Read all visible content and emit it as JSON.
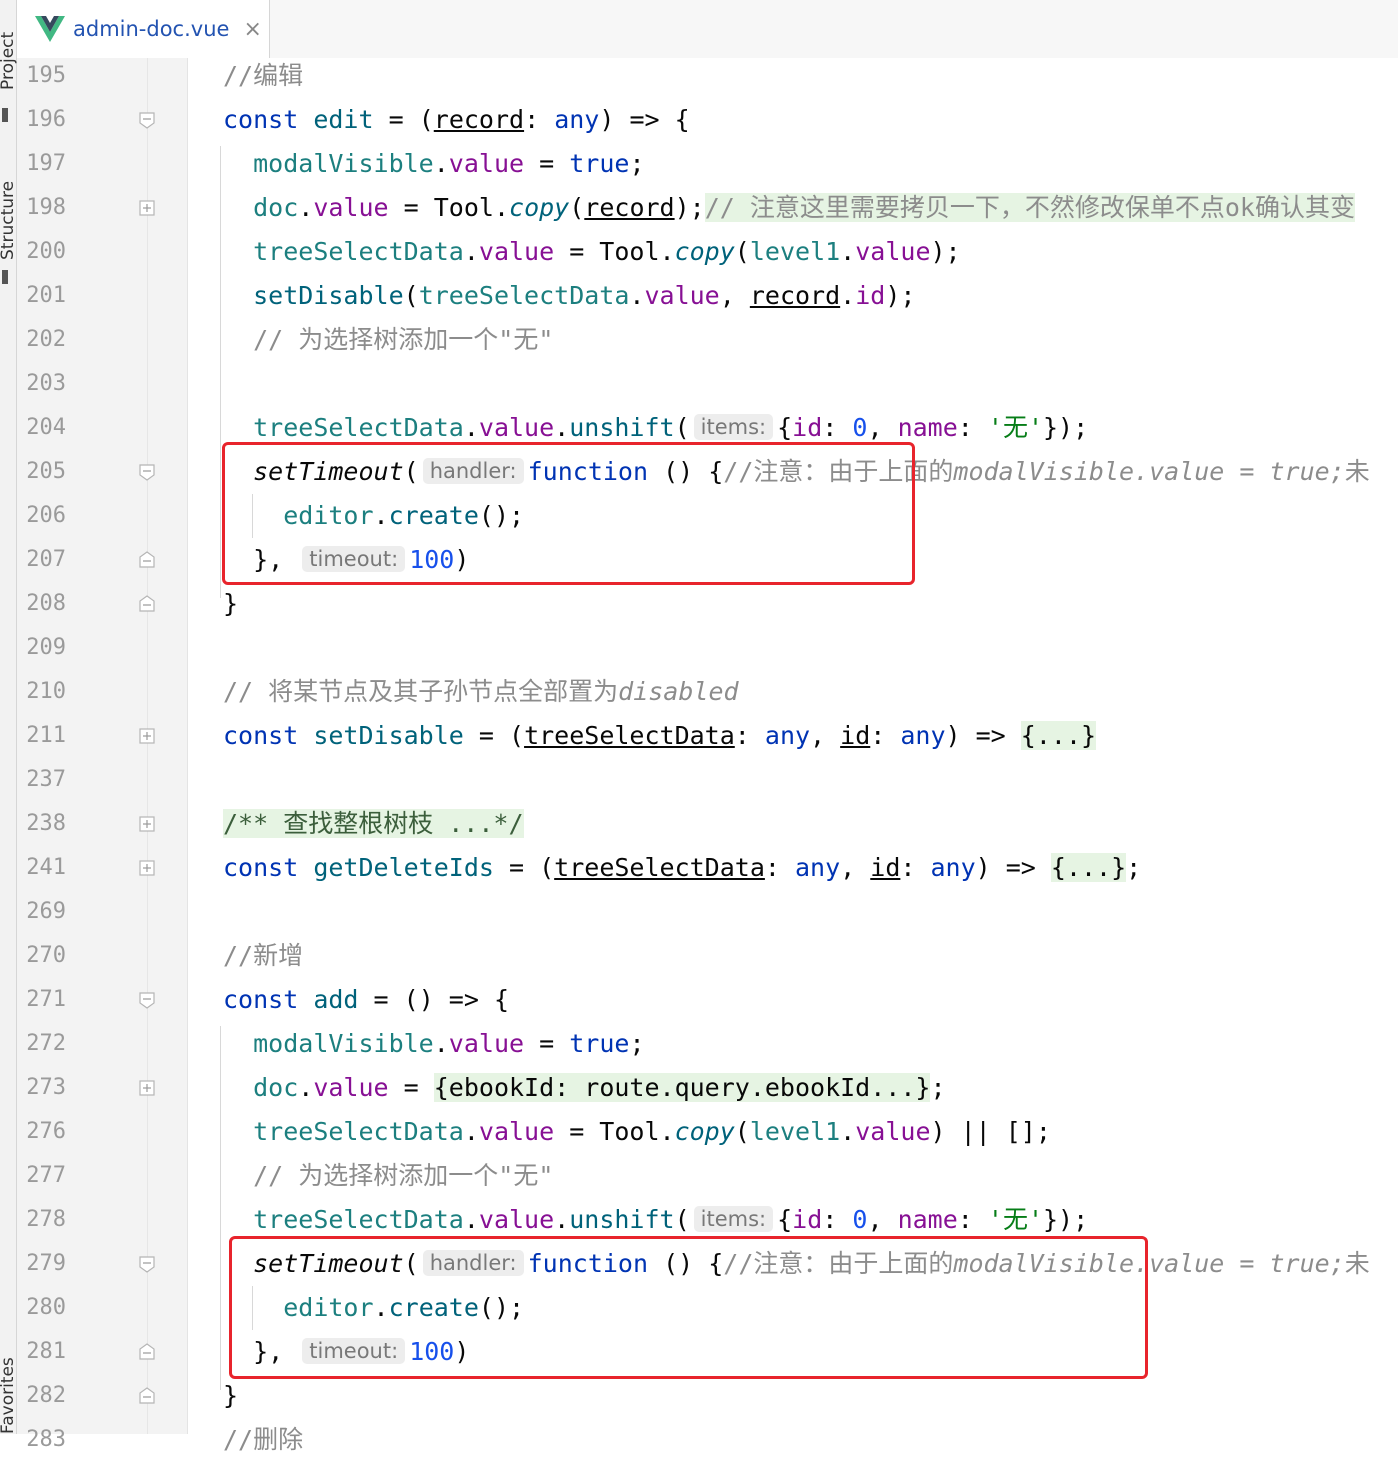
{
  "tab": {
    "label": "admin-doc.vue",
    "close_glyph": "×"
  },
  "side": {
    "top_label": "Project",
    "mid_label": "Structure",
    "bottom_label": "Favorites"
  },
  "colors": {
    "keyword": "#0033b3",
    "property": "#871094",
    "string": "#067d17",
    "number": "#1750eb",
    "comment": "#8c8c8c",
    "highlight_box": "#e8242c"
  },
  "lines": [
    {
      "n": "195"
    },
    {
      "n": "196"
    },
    {
      "n": "197"
    },
    {
      "n": "198"
    },
    {
      "n": "200"
    },
    {
      "n": "201"
    },
    {
      "n": "202"
    },
    {
      "n": "203"
    },
    {
      "n": "204"
    },
    {
      "n": "205"
    },
    {
      "n": "206"
    },
    {
      "n": "207"
    },
    {
      "n": "208"
    },
    {
      "n": "209"
    },
    {
      "n": "210"
    },
    {
      "n": "211"
    },
    {
      "n": "237"
    },
    {
      "n": "238"
    },
    {
      "n": "241"
    },
    {
      "n": "269"
    },
    {
      "n": "270"
    },
    {
      "n": "271"
    },
    {
      "n": "272"
    },
    {
      "n": "273"
    },
    {
      "n": "276"
    },
    {
      "n": "277"
    },
    {
      "n": "278"
    },
    {
      "n": "279"
    },
    {
      "n": "280"
    },
    {
      "n": "281"
    },
    {
      "n": "282"
    },
    {
      "n": "283"
    }
  ],
  "text": {
    "c195": "//编辑",
    "c198_comment": "// 注意这里需要拷贝一下，不然修改保单不点ok确认其变",
    "c202": "// 为选择树添加一个\"无\"",
    "c205_comment": "//注意：由于上面的",
    "c205_comment_i": "modalVisible.value = true;",
    "c205_tail": "未",
    "c210": "// 将某节点及其子孙节点全部置为",
    "c210_i": "disabled",
    "c238": "/** 查找整根树枝 ...*/",
    "c270": "//新增",
    "c277": "// 为选择树添加一个\"无\"",
    "c279_comment": "//注意：由于上面的",
    "c279_comment_i": "modalVisible.value = true;",
    "c279_tail": "未",
    "c283": "//删除",
    "hint_items": "items:",
    "hint_handler": "handler:",
    "hint_timeout": "timeout:",
    "str_wu": "'无'",
    "num_zero": "0",
    "num_100": "100",
    "folded": "{...}",
    "folded_doc": "{ebookId: route.query.ebookId...}"
  }
}
